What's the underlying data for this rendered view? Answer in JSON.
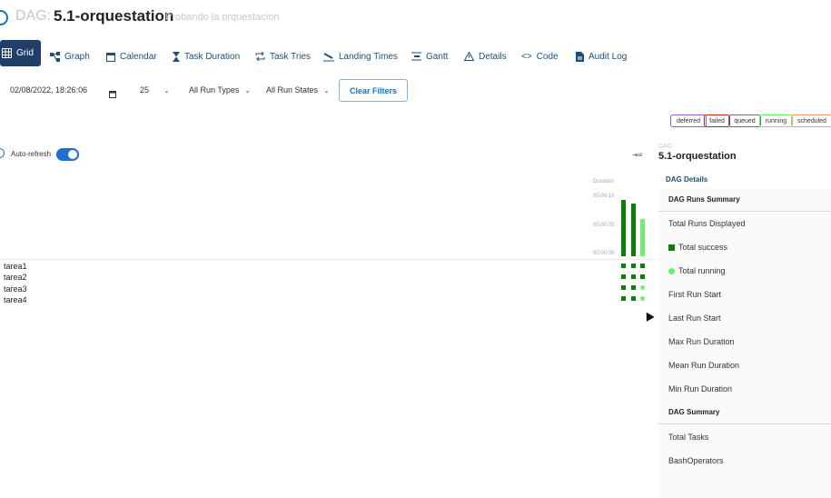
{
  "header": {
    "prefix": "DAG:",
    "dag_id": "5.1-orquestation",
    "description": "Probando la orquestacion"
  },
  "tabs": [
    {
      "label": "Grid",
      "icon": "grid-icon",
      "active": true
    },
    {
      "label": "Graph",
      "icon": "graph-icon"
    },
    {
      "label": "Calendar",
      "icon": "calendar-icon"
    },
    {
      "label": "Task Duration",
      "icon": "hourglass-icon"
    },
    {
      "label": "Task Tries",
      "icon": "retry-icon"
    },
    {
      "label": "Landing Times",
      "icon": "landing-icon"
    },
    {
      "label": "Gantt",
      "icon": "gantt-icon"
    },
    {
      "label": "Details",
      "icon": "warning-icon"
    },
    {
      "label": "Code",
      "icon": "code-icon"
    },
    {
      "label": "Audit Log",
      "icon": "document-icon"
    }
  ],
  "filters": {
    "base_date": "02/08/2022, 18:26:06",
    "num_runs": "25",
    "run_types": "All Run Types",
    "run_states": "All Run States",
    "clear_label": "Clear Filters"
  },
  "legend": [
    {
      "label": "deferred",
      "color": "#9b59d0"
    },
    {
      "label": "failed",
      "color": "#d11c1c"
    },
    {
      "label": "queued",
      "color": "#6b6b6b"
    },
    {
      "label": "running",
      "color": "#6df06d"
    },
    {
      "label": "scheduled",
      "color": "#e6a27a"
    }
  ],
  "auto_refresh": {
    "label": "Auto-refresh",
    "enabled": true
  },
  "duration_chart": {
    "label": "Duration",
    "ticks": [
      "00:00:10",
      "00:00:05",
      "00:00:00"
    ]
  },
  "tasks": [
    {
      "name": "tarea1",
      "states": [
        "success",
        "success",
        "success"
      ]
    },
    {
      "name": "tarea2",
      "states": [
        "success",
        "success",
        "success"
      ]
    },
    {
      "name": "tarea3",
      "states": [
        "success",
        "success",
        "running"
      ]
    },
    {
      "name": "tarea4",
      "states": [
        "success",
        "success",
        "running"
      ]
    }
  ],
  "runs": [
    {
      "state": "success",
      "duration_sec": 9.6
    },
    {
      "state": "success",
      "duration_sec": 9.0
    },
    {
      "state": "running",
      "duration_sec": 6.3
    }
  ],
  "colors": {
    "success": "#0b7d0b",
    "running": "#6df06d",
    "accent": "#1a73b8",
    "nav": "#1f3f68"
  },
  "panel": {
    "dag_label": "DAG",
    "dag_id": "5.1-orquestation",
    "details_link": "DAG Details",
    "runs_summary": "DAG Runs Summary",
    "total_runs": "Total Runs Displayed",
    "total_success": "Total success",
    "total_running": "Total running",
    "first_run_start": "First Run Start",
    "last_run_start": "Last Run Start",
    "max_run_duration": "Max Run Duration",
    "mean_run_duration": "Mean Run Duration",
    "min_run_duration": "Min Run Duration",
    "dag_summary": "DAG Summary",
    "total_tasks": "Total Tasks",
    "bash_operators": "BashOperators"
  }
}
